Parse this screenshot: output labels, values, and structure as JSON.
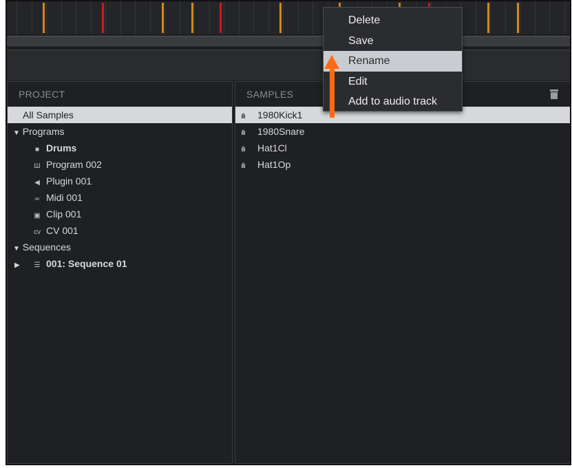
{
  "project_panel": {
    "header": "PROJECT",
    "items": [
      {
        "label": "All Samples",
        "icon": "",
        "selected": true
      },
      {
        "label": "Programs",
        "icon": "▼",
        "indent": 0
      },
      {
        "label": "Drums",
        "icon": "grid-icon",
        "indent": 1,
        "bold": true
      },
      {
        "label": "Program 002",
        "icon": "keyboard-icon",
        "indent": 1
      },
      {
        "label": "Plugin 001",
        "icon": "plugin-icon",
        "indent": 1
      },
      {
        "label": "Midi 001",
        "icon": "midi-icon",
        "indent": 1
      },
      {
        "label": "Clip 001",
        "icon": "clip-icon",
        "indent": 1
      },
      {
        "label": "CV 001",
        "icon": "cv-icon",
        "indent": 1
      },
      {
        "label": "Sequences",
        "icon": "▼",
        "indent": 0
      },
      {
        "label": "001: Sequence 01",
        "icon": "sequence-icon",
        "indent": 1,
        "bold": true
      }
    ]
  },
  "samples_panel": {
    "header": "SAMPLES",
    "items": [
      {
        "label": "1980Kick1",
        "selected": true
      },
      {
        "label": "1980Snare"
      },
      {
        "label": "Hat1Cl"
      },
      {
        "label": "Hat1Op"
      }
    ]
  },
  "context_menu": {
    "items": [
      "Delete",
      "Save",
      "Rename",
      "Edit",
      "Add to audio track"
    ],
    "hovered_index": 2
  },
  "colors": {
    "accent_arrow": "#ff6a13",
    "timeline_orange": "#d48a1c",
    "timeline_red": "#c81e1e"
  }
}
